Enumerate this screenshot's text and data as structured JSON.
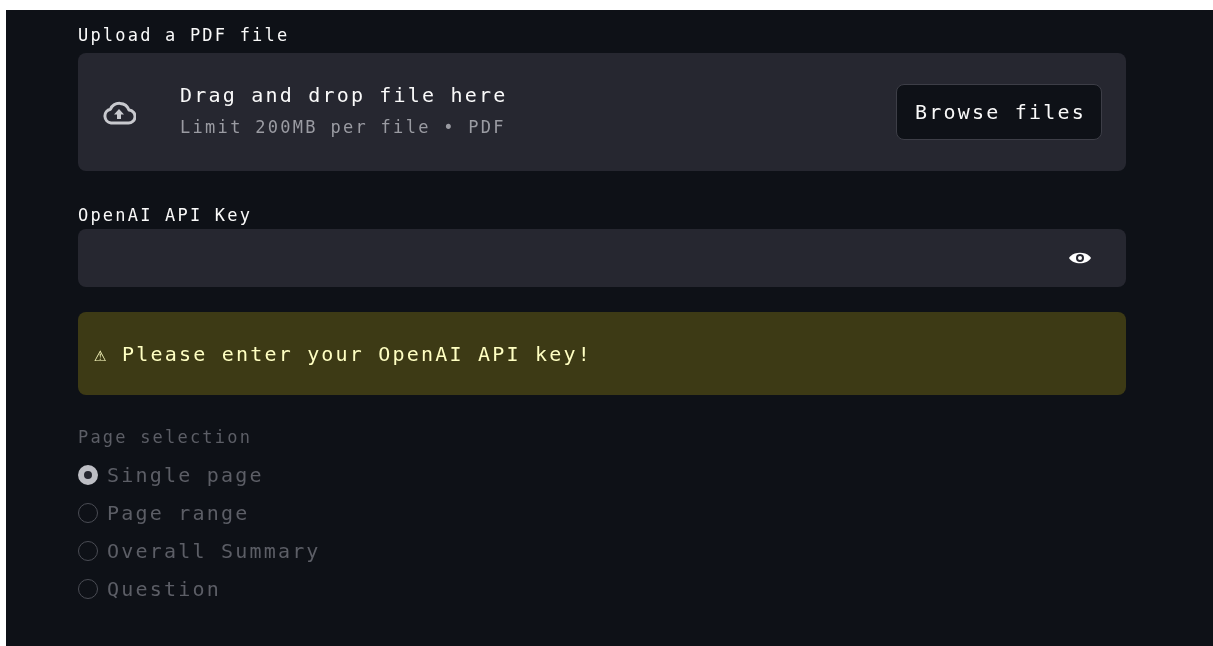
{
  "uploader": {
    "label": "Upload a PDF file",
    "title": "Drag and drop file here",
    "hint": "Limit 200MB per file • PDF",
    "button": "Browse files"
  },
  "api_key": {
    "label": "OpenAI API Key",
    "masked": true
  },
  "warning": {
    "kind": "warning",
    "icon": "⚠",
    "text": "Please enter your OpenAI API key!"
  },
  "page_selection": {
    "label": "Page selection",
    "disabled": true,
    "options": [
      {
        "label": "Single page",
        "selected": true
      },
      {
        "label": "Page range",
        "selected": false
      },
      {
        "label": "Overall Summary",
        "selected": false
      },
      {
        "label": "Question",
        "selected": false
      }
    ]
  }
}
